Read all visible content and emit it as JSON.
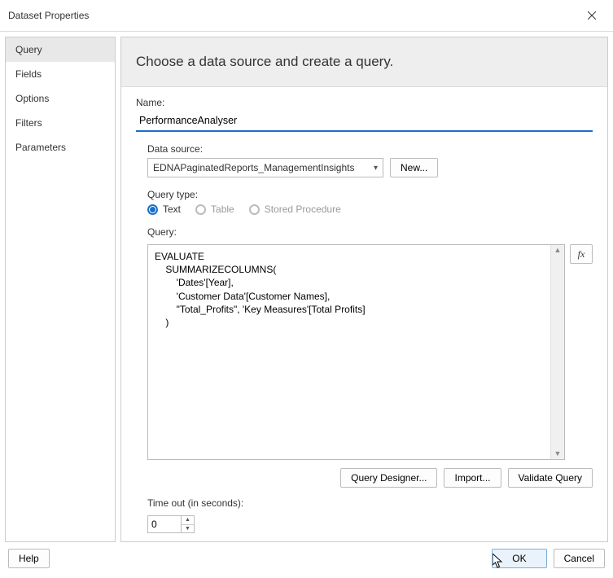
{
  "window": {
    "title": "Dataset Properties"
  },
  "sidebar": {
    "items": [
      {
        "label": "Query",
        "selected": true
      },
      {
        "label": "Fields"
      },
      {
        "label": "Options"
      },
      {
        "label": "Filters"
      },
      {
        "label": "Parameters"
      }
    ]
  },
  "header": {
    "title": "Choose a data source and create a query."
  },
  "name": {
    "label": "Name:",
    "value": "PerformanceAnalyser"
  },
  "dataSource": {
    "label": "Data source:",
    "selected": "EDNAPaginatedReports_ManagementInsights",
    "newLabel": "New..."
  },
  "queryType": {
    "label": "Query type:",
    "options": [
      {
        "label": "Text",
        "selected": true
      },
      {
        "label": "Table"
      },
      {
        "label": "Stored Procedure"
      }
    ]
  },
  "query": {
    "label": "Query:",
    "text": "EVALUATE\n    SUMMARIZECOLUMNS(\n        'Dates'[Year],\n        'Customer Data'[Customer Names],\n        \"Total_Profits\", 'Key Measures'[Total Profits]\n    )",
    "fxLabel": "fx"
  },
  "queryButtons": {
    "designer": "Query Designer...",
    "import": "Import...",
    "validate": "Validate Query"
  },
  "timeout": {
    "label": "Time out (in seconds):",
    "value": "0"
  },
  "footer": {
    "help": "Help",
    "ok": "OK",
    "cancel": "Cancel"
  }
}
